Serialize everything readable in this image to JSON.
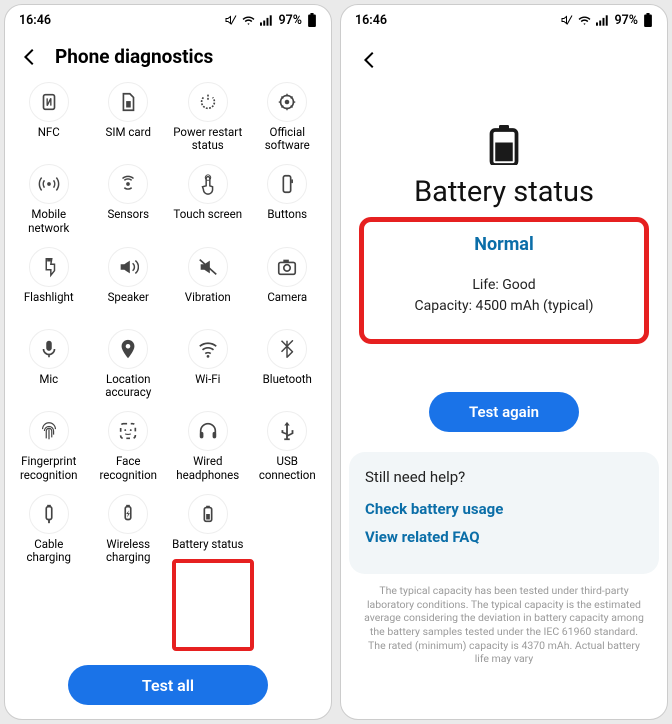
{
  "status": {
    "time": "16:46",
    "battery_pct": "97%"
  },
  "screen1": {
    "title": "Phone diagnostics",
    "tiles": [
      {
        "id": "nfc",
        "label": "NFC"
      },
      {
        "id": "sim",
        "label": "SIM card"
      },
      {
        "id": "powerrestart",
        "label": "Power restart status"
      },
      {
        "id": "software",
        "label": "Official software"
      },
      {
        "id": "mobilenet",
        "label": "Mobile network"
      },
      {
        "id": "sensors",
        "label": "Sensors"
      },
      {
        "id": "touch",
        "label": "Touch screen"
      },
      {
        "id": "buttons",
        "label": "Buttons"
      },
      {
        "id": "flash",
        "label": "Flashlight"
      },
      {
        "id": "speaker",
        "label": "Speaker"
      },
      {
        "id": "vibration",
        "label": "Vibration"
      },
      {
        "id": "camera",
        "label": "Camera"
      },
      {
        "id": "mic",
        "label": "Mic"
      },
      {
        "id": "location",
        "label": "Location accuracy"
      },
      {
        "id": "wifi",
        "label": "Wi-Fi"
      },
      {
        "id": "bluetooth",
        "label": "Bluetooth"
      },
      {
        "id": "fingerprint",
        "label": "Fingerprint recognition"
      },
      {
        "id": "face",
        "label": "Face recognition"
      },
      {
        "id": "headphones",
        "label": "Wired headphones"
      },
      {
        "id": "usb",
        "label": "USB connection"
      },
      {
        "id": "cable",
        "label": "Cable charging"
      },
      {
        "id": "wireless",
        "label": "Wireless charging"
      },
      {
        "id": "battery",
        "label": "Battery status"
      }
    ],
    "test_all": "Test all"
  },
  "screen2": {
    "title": "Battery status",
    "status_main": "Normal",
    "life_label": "Life: Good",
    "capacity_label": "Capacity: 4500 mAh (typical)",
    "test_again": "Test again",
    "help_title": "Still need help?",
    "help_link1": "Check battery usage",
    "help_link2": "View related FAQ",
    "fineprint": "The typical capacity has been tested under third-party laboratory conditions. The typical capacity is the estimated average considering the deviation in battery capacity among the battery samples tested under the IEC 61960 standard. The rated (minimum) capacity is 4370 mAh. Actual battery life may vary"
  }
}
